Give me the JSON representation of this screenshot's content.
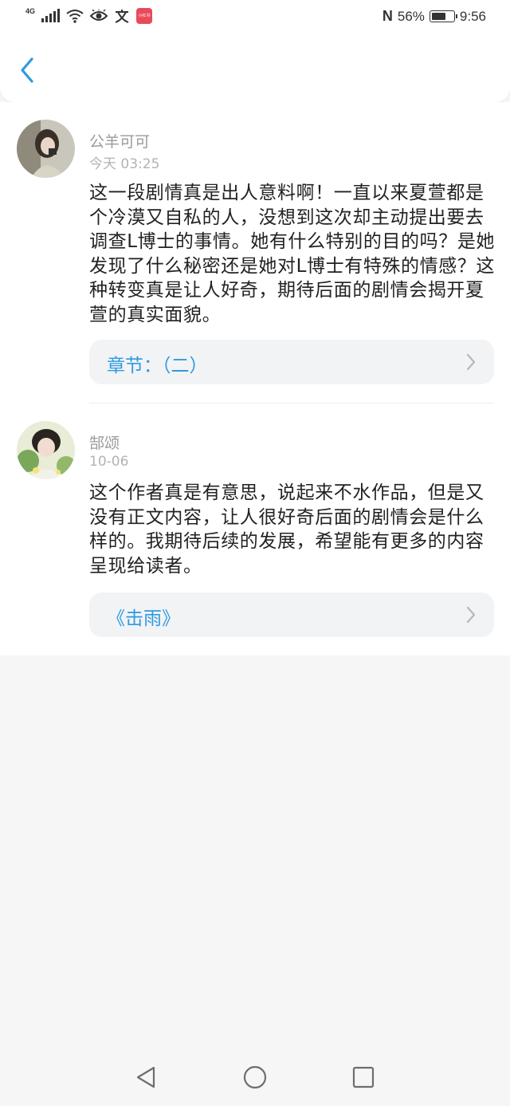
{
  "status_bar": {
    "network": "4G",
    "battery_percent": "56%",
    "battery_level": 0.56,
    "time": "9:56",
    "icons": [
      "signal-icon",
      "wifi-icon",
      "eye-icon",
      "text-icon",
      "app-notification-icon",
      "nfc-icon",
      "battery-icon"
    ],
    "app_badge_text": "小红书"
  },
  "top_bar": {
    "back_icon": "chevron-left-icon",
    "accent_color": "#2f9ae0"
  },
  "comments": [
    {
      "username": "公羊可可",
      "time": "今天 03:25",
      "content": "这一段剧情真是出人意料啊！一直以来夏萱都是个冷漠又自私的人，没想到这次却主动提出要去调查L博士的事情。她有什么特别的目的吗？是她发现了什么秘密还是她对L博士有特殊的情感？这种转变真是让人好奇，期待后面的剧情会揭开夏萱的真实面貌。",
      "link_label": "章节：（二）"
    },
    {
      "username": "郜颂",
      "time": "10-06",
      "content": "这个作者真是有意思，说起来不水作品，但是又没有正文内容，让人很好奇后面的剧情会是什么样的。我期待后续的发展，希望能有更多的内容呈现给读者。",
      "link_label": "《击雨》"
    }
  ],
  "nav_bar": {
    "buttons": [
      "back-triangle-icon",
      "home-circle-icon",
      "recents-square-icon"
    ]
  }
}
